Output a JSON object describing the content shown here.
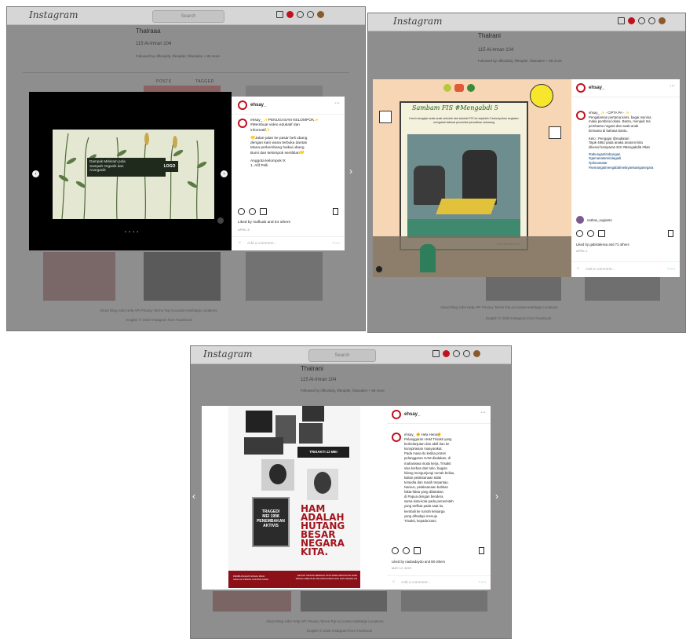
{
  "app": {
    "name": "Instagram",
    "search_placeholder": "Search"
  },
  "profile": {
    "name": "Thalrani",
    "name_s1": "Thalraaa",
    "posts_line": "115 Al-Imran 104",
    "followed_by": "Followed by officialubj, liferapler, hibasalen + 88 more"
  },
  "tabs": {
    "posts": "POSTS",
    "tagged": "TAGGED"
  },
  "footer": {
    "links": "About  Blog  Jobs  Help  API  Privacy  Terms  Top Accounts  Hashtags  Locations",
    "copyright": "English  ©  2020 Instagram from Facebook"
  },
  "posts": [
    {
      "username": "ehsay_",
      "caption_lines": [
        "ehsay_ ✨PENUGASAN KELOMPOK✨",
        "#Membuat video edukatif dan",
        "informatif✨",
        "",
        "💛Jalan-jalan ke pasar beli ubang",
        "dengan kain wana terbuka dantas",
        "Mana perkembang haikai ubang",
        "Bumi dan kelompok sembilan💛",
        "",
        "Anggota kelompok 9:",
        "1. Afif Pelli"
      ],
      "slide_text": [
        "Dampak Miskram pola",
        "Sampah Organik dan",
        "Anorganik"
      ],
      "slide_logo": "LOGO",
      "liked_by": "Liked by mafluab and 54 others",
      "date": "APRIL 8",
      "comment_placeholder": "Add a comment...",
      "post_label": "Post"
    },
    {
      "username": "ehsay_",
      "caption_lines": [
        "ehsay_ ✨ - CIPTA PA - ✨",
        "Pengalaman pertama kami, bagai menina",
        "maka pembina lokasi. Bantu, menjadi Ina",
        "pembantu negara dan anak-anak",
        "bersama di bahasa bantu.",
        "",
        "Kelo : Pengajar @nadiatari",
        "Tajuk 4862 pada anaka anatomi kita",
        "dikenal hamparan EIS #Mengabdi5 #Ikat",
        ""
      ],
      "hashtags": [
        "#tabungantimbangan",
        "#gamanatamiridagadi",
        "#pilonanatar",
        "#semangatmengabdimelayaniwarganegara"
      ],
      "banner_title": "Sambam FIS #Mengabdi 5",
      "banner_caption": "Kami mengajar anak-anak sekolah dari sekolah FIS ke sejaklah 3 kelompokan kegiatan mengabdi kalimat penuhilah pemulihan sekarang",
      "frame_tag": "#Cerpena5 2019",
      "commenter": "nathan_sugianto",
      "liked_by": "Liked by gabstalessa and 72 others",
      "date": "APRIL 1",
      "comment_placeholder": "Add a comment...",
      "post_label": "Post"
    },
    {
      "username": "ehsay_",
      "caption_lines": [
        "ehsay_ ✊ Hela Hena✊",
        "Pelanggaran HAM Trisakti yang",
        "berkelanjutan dan aktif dan ke",
        "konspirasian masyarakat.",
        "Pada masa itu ketika protes",
        "pelanggaran HAM diadakan, di",
        "mahasiswa mulai kerja, Trisakti",
        "sisa korban dari toko, bagian",
        "hilang mengunjungi rumah beliau,",
        "kalian pelaksanaan tidak",
        "tersedia dan masih terpantau.",
        "Namun, pelaksanaan bahkan",
        "fakta-fakta yang dilakukan",
        "di Papua dengan bendera",
        "sama kota-kota pada pemerintah",
        "yang terlibat pada saat itu,",
        "kembali ke rumah keluarga",
        "yang dihadapi menuju",
        "Trisakti, kepada kami."
      ],
      "poster_big": [
        "HAM",
        "ADALAH",
        "HUTANG",
        "BESAR",
        "NEGARA",
        "KITA."
      ],
      "poster_trisakti": "TRISAKTI 12 MEI",
      "poster_tragedi": [
        "TRAGEDI",
        "MEI 1998",
        "PENEMBAKAN",
        "AKTIVIS"
      ],
      "poster_footer_left": "PEMBUNUHAN MASAL BAGI ADALAH\nPENUH KONTRA DIAM",
      "poster_footer_right": "SETIAP ORANG BERHAK ATAS PERLINDUNGAN DARI SEGALA BENTUK\nPELANGGARAN HAK DAN KEADILAN",
      "liked_by": "Liked by nadasdaydo and 88 others",
      "date": "MAY 12, 2020",
      "comment_placeholder": "Add a comment...",
      "post_label": "Post"
    }
  ],
  "colors": {
    "brand_red": "#c0121d",
    "link_blue": "#00376b",
    "overlay_gray": "#8e8e8e"
  }
}
